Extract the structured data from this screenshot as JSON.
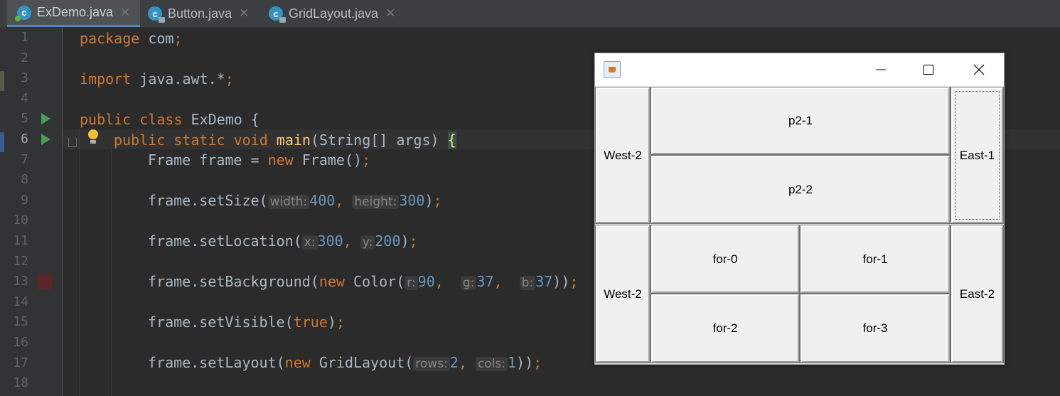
{
  "tabs": [
    {
      "label": "ExDemo.java",
      "icon": "java-class-icon",
      "active": true
    },
    {
      "label": "Button.java",
      "icon": "java-class-locked-icon",
      "active": false
    },
    {
      "label": "GridLayout.java",
      "icon": "java-class-locked-icon",
      "active": false
    }
  ],
  "line_numbers": [
    "1",
    "2",
    "3",
    "4",
    "5",
    "6",
    "7",
    "8",
    "9",
    "10",
    "11",
    "12",
    "13",
    "14",
    "15",
    "16",
    "17",
    "18"
  ],
  "code": {
    "l1": {
      "kw": "package",
      "rest": " com",
      "semi": ";"
    },
    "l3": {
      "kw": "import",
      "rest": " java.awt.*",
      "semi": ";"
    },
    "l5": {
      "kw": "public class",
      "rest": " ExDemo {"
    },
    "l6": {
      "kw": "public static void",
      "fn": "main",
      "rest": "(String[] args) ",
      "brace": "{"
    },
    "l7": {
      "pre": "Frame frame = ",
      "kw": "new",
      "rest": " Frame()",
      "semi": ";"
    },
    "l9": {
      "pre": "frame.setSize(",
      "h1": "width:",
      "v1": "400",
      "h2": "height:",
      "v2": "300",
      "post": ")",
      "semi": ";"
    },
    "l11": {
      "pre": "frame.setLocation(",
      "h1": "x:",
      "v1": "300",
      "h2": "y:",
      "v2": "200",
      "post": ")",
      "semi": ";"
    },
    "l13": {
      "pre": "frame.setBackground(",
      "kw": "new",
      "mid": " Color(",
      "h1": "r:",
      "v1": "90",
      "h2": "g:",
      "v2": "37",
      "h3": "b:",
      "v3": "37",
      "post": "))",
      "semi": ";"
    },
    "l15": {
      "pre": "frame.setVisible(",
      "kw": "true",
      "post": ")",
      "semi": ";"
    },
    "l17": {
      "pre": "frame.setLayout(",
      "kw": "new",
      "mid": " GridLayout(",
      "h1": "rows:",
      "v1": "2",
      "h2": "cols:",
      "v2": "1",
      "post": "))",
      "semi": ";"
    }
  },
  "frame": {
    "title_icon": "java-cup-icon",
    "controls": {
      "minimize": "─",
      "maximize": "☐",
      "close": "✕"
    },
    "buttons": {
      "west_top": "West-2",
      "p2_1": "p2-1",
      "p2_2": "p2-2",
      "east_1": "East-1",
      "west_bottom": "West-2",
      "for_0": "for-0",
      "for_1": "for-1",
      "for_2": "for-2",
      "for_3": "for-3",
      "east_2": "East-2"
    }
  },
  "colors": {
    "editor_bg": "#2b2b2b",
    "keyword": "#cc7832",
    "function": "#ffc66d",
    "number": "#6897bb",
    "identifier": "#a9b7c6"
  }
}
